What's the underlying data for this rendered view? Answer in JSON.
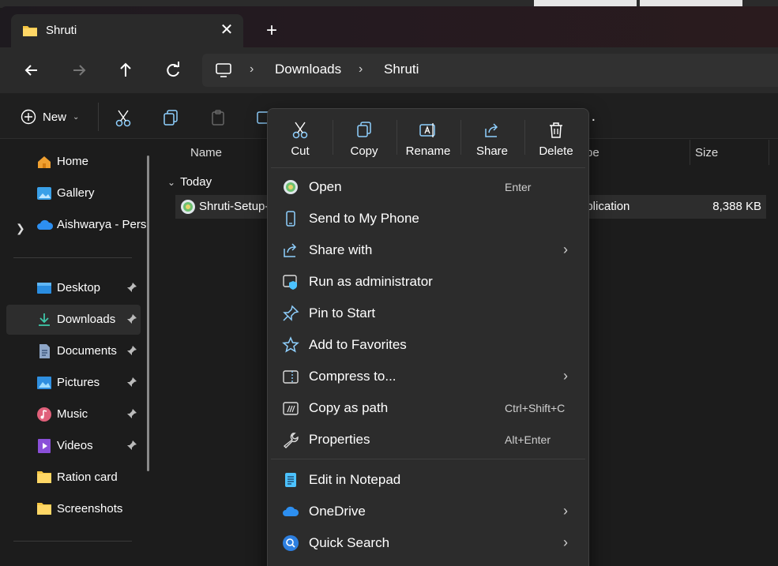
{
  "tab": {
    "title": "Shruti",
    "close": "✕",
    "new": "+"
  },
  "address": {
    "crumbs": [
      "Downloads",
      "Shruti"
    ]
  },
  "cmdbar": {
    "new_label": "New"
  },
  "sidebar": {
    "items": [
      {
        "label": "Home"
      },
      {
        "label": "Gallery"
      },
      {
        "label": "Aishwarya - Pers"
      },
      {
        "label": "Desktop"
      },
      {
        "label": "Downloads"
      },
      {
        "label": "Documents"
      },
      {
        "label": "Pictures"
      },
      {
        "label": "Music"
      },
      {
        "label": "Videos"
      },
      {
        "label": "Ration card"
      },
      {
        "label": "Screenshots"
      }
    ]
  },
  "columns": {
    "name": "Name",
    "type": "pe",
    "size": "Size"
  },
  "group": {
    "label": "Today"
  },
  "file": {
    "name": "Shruti-Setup-",
    "type": "pplication",
    "size": "8,388 KB"
  },
  "context_menu": {
    "quick_actions": [
      {
        "label": "Cut"
      },
      {
        "label": "Copy"
      },
      {
        "label": "Rename"
      },
      {
        "label": "Share"
      },
      {
        "label": "Delete"
      }
    ],
    "items": [
      {
        "label": "Open",
        "shortcut": "Enter"
      },
      {
        "label": "Send to My Phone"
      },
      {
        "label": "Share with"
      },
      {
        "label": "Run as administrator"
      },
      {
        "label": "Pin to Start"
      },
      {
        "label": "Add to Favorites"
      },
      {
        "label": "Compress to..."
      },
      {
        "label": "Copy as path",
        "shortcut": "Ctrl+Shift+C"
      },
      {
        "label": "Properties",
        "shortcut": "Alt+Enter"
      },
      {
        "label": "Edit in Notepad"
      },
      {
        "label": "OneDrive"
      },
      {
        "label": "Quick Search"
      }
    ]
  },
  "colors": {
    "accent": "#4cc2ff",
    "folder": "#f5c542",
    "menu_bg": "#2c2c2c"
  }
}
